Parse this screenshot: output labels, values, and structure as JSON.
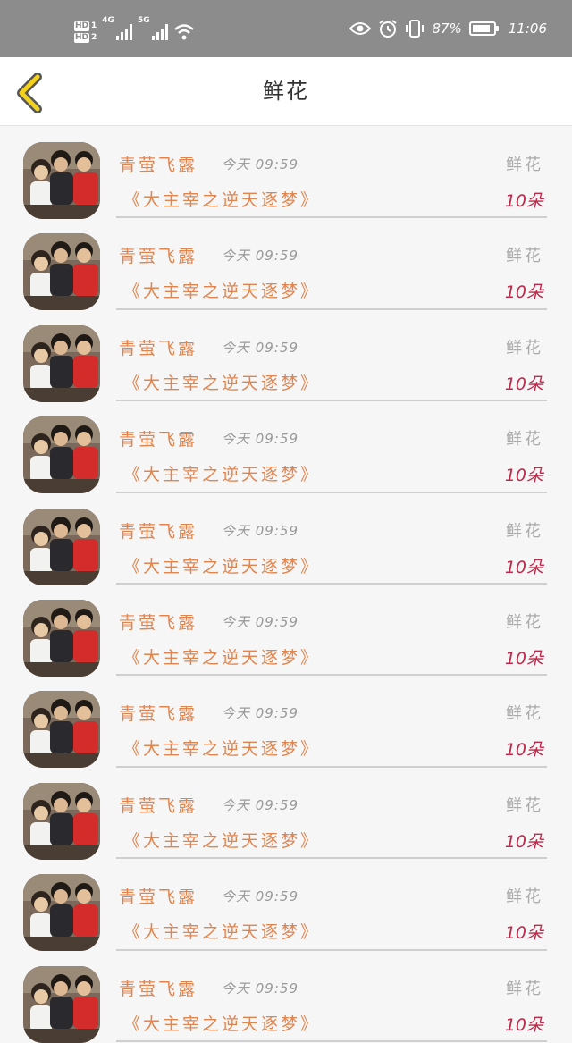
{
  "status_bar": {
    "hd1": "HD",
    "hd1_sub": "1",
    "hd2": "HD",
    "hd2_sub": "2",
    "net1": "4G",
    "net2": "5G",
    "battery_percent": "87%",
    "battery_level": 0.87,
    "time": "11:06",
    "icons": [
      "hd-icon",
      "signal-icon",
      "wifi-icon",
      "eye-icon",
      "alarm-icon",
      "vibrate-icon",
      "battery-icon"
    ]
  },
  "header": {
    "title": "鲜花",
    "back_icon": "chevron-left-icon",
    "accent_color": "#f2d21b"
  },
  "items": [
    {
      "name": "青萤飞露",
      "time": "今天 09:59",
      "gift": "鲜花",
      "novel": "《大主宰之逆天逐梦》",
      "count": "10朵"
    },
    {
      "name": "青萤飞露",
      "time": "今天 09:59",
      "gift": "鲜花",
      "novel": "《大主宰之逆天逐梦》",
      "count": "10朵"
    },
    {
      "name": "青萤飞露",
      "time": "今天 09:59",
      "gift": "鲜花",
      "novel": "《大主宰之逆天逐梦》",
      "count": "10朵"
    },
    {
      "name": "青萤飞露",
      "time": "今天 09:59",
      "gift": "鲜花",
      "novel": "《大主宰之逆天逐梦》",
      "count": "10朵"
    },
    {
      "name": "青萤飞露",
      "time": "今天 09:59",
      "gift": "鲜花",
      "novel": "《大主宰之逆天逐梦》",
      "count": "10朵"
    },
    {
      "name": "青萤飞露",
      "time": "今天 09:59",
      "gift": "鲜花",
      "novel": "《大主宰之逆天逐梦》",
      "count": "10朵"
    },
    {
      "name": "青萤飞露",
      "time": "今天 09:59",
      "gift": "鲜花",
      "novel": "《大主宰之逆天逐梦》",
      "count": "10朵"
    },
    {
      "name": "青萤飞露",
      "time": "今天 09:59",
      "gift": "鲜花",
      "novel": "《大主宰之逆天逐梦》",
      "count": "10朵"
    },
    {
      "name": "青萤飞露",
      "time": "今天 09:59",
      "gift": "鲜花",
      "novel": "《大主宰之逆天逐梦》",
      "count": "10朵"
    },
    {
      "name": "青萤飞露",
      "time": "今天 09:59",
      "gift": "鲜花",
      "novel": "《大主宰之逆天逐梦》",
      "count": "10朵"
    }
  ],
  "colors": {
    "name": "#e2844e",
    "count": "#c0284a",
    "muted": "#999999"
  }
}
